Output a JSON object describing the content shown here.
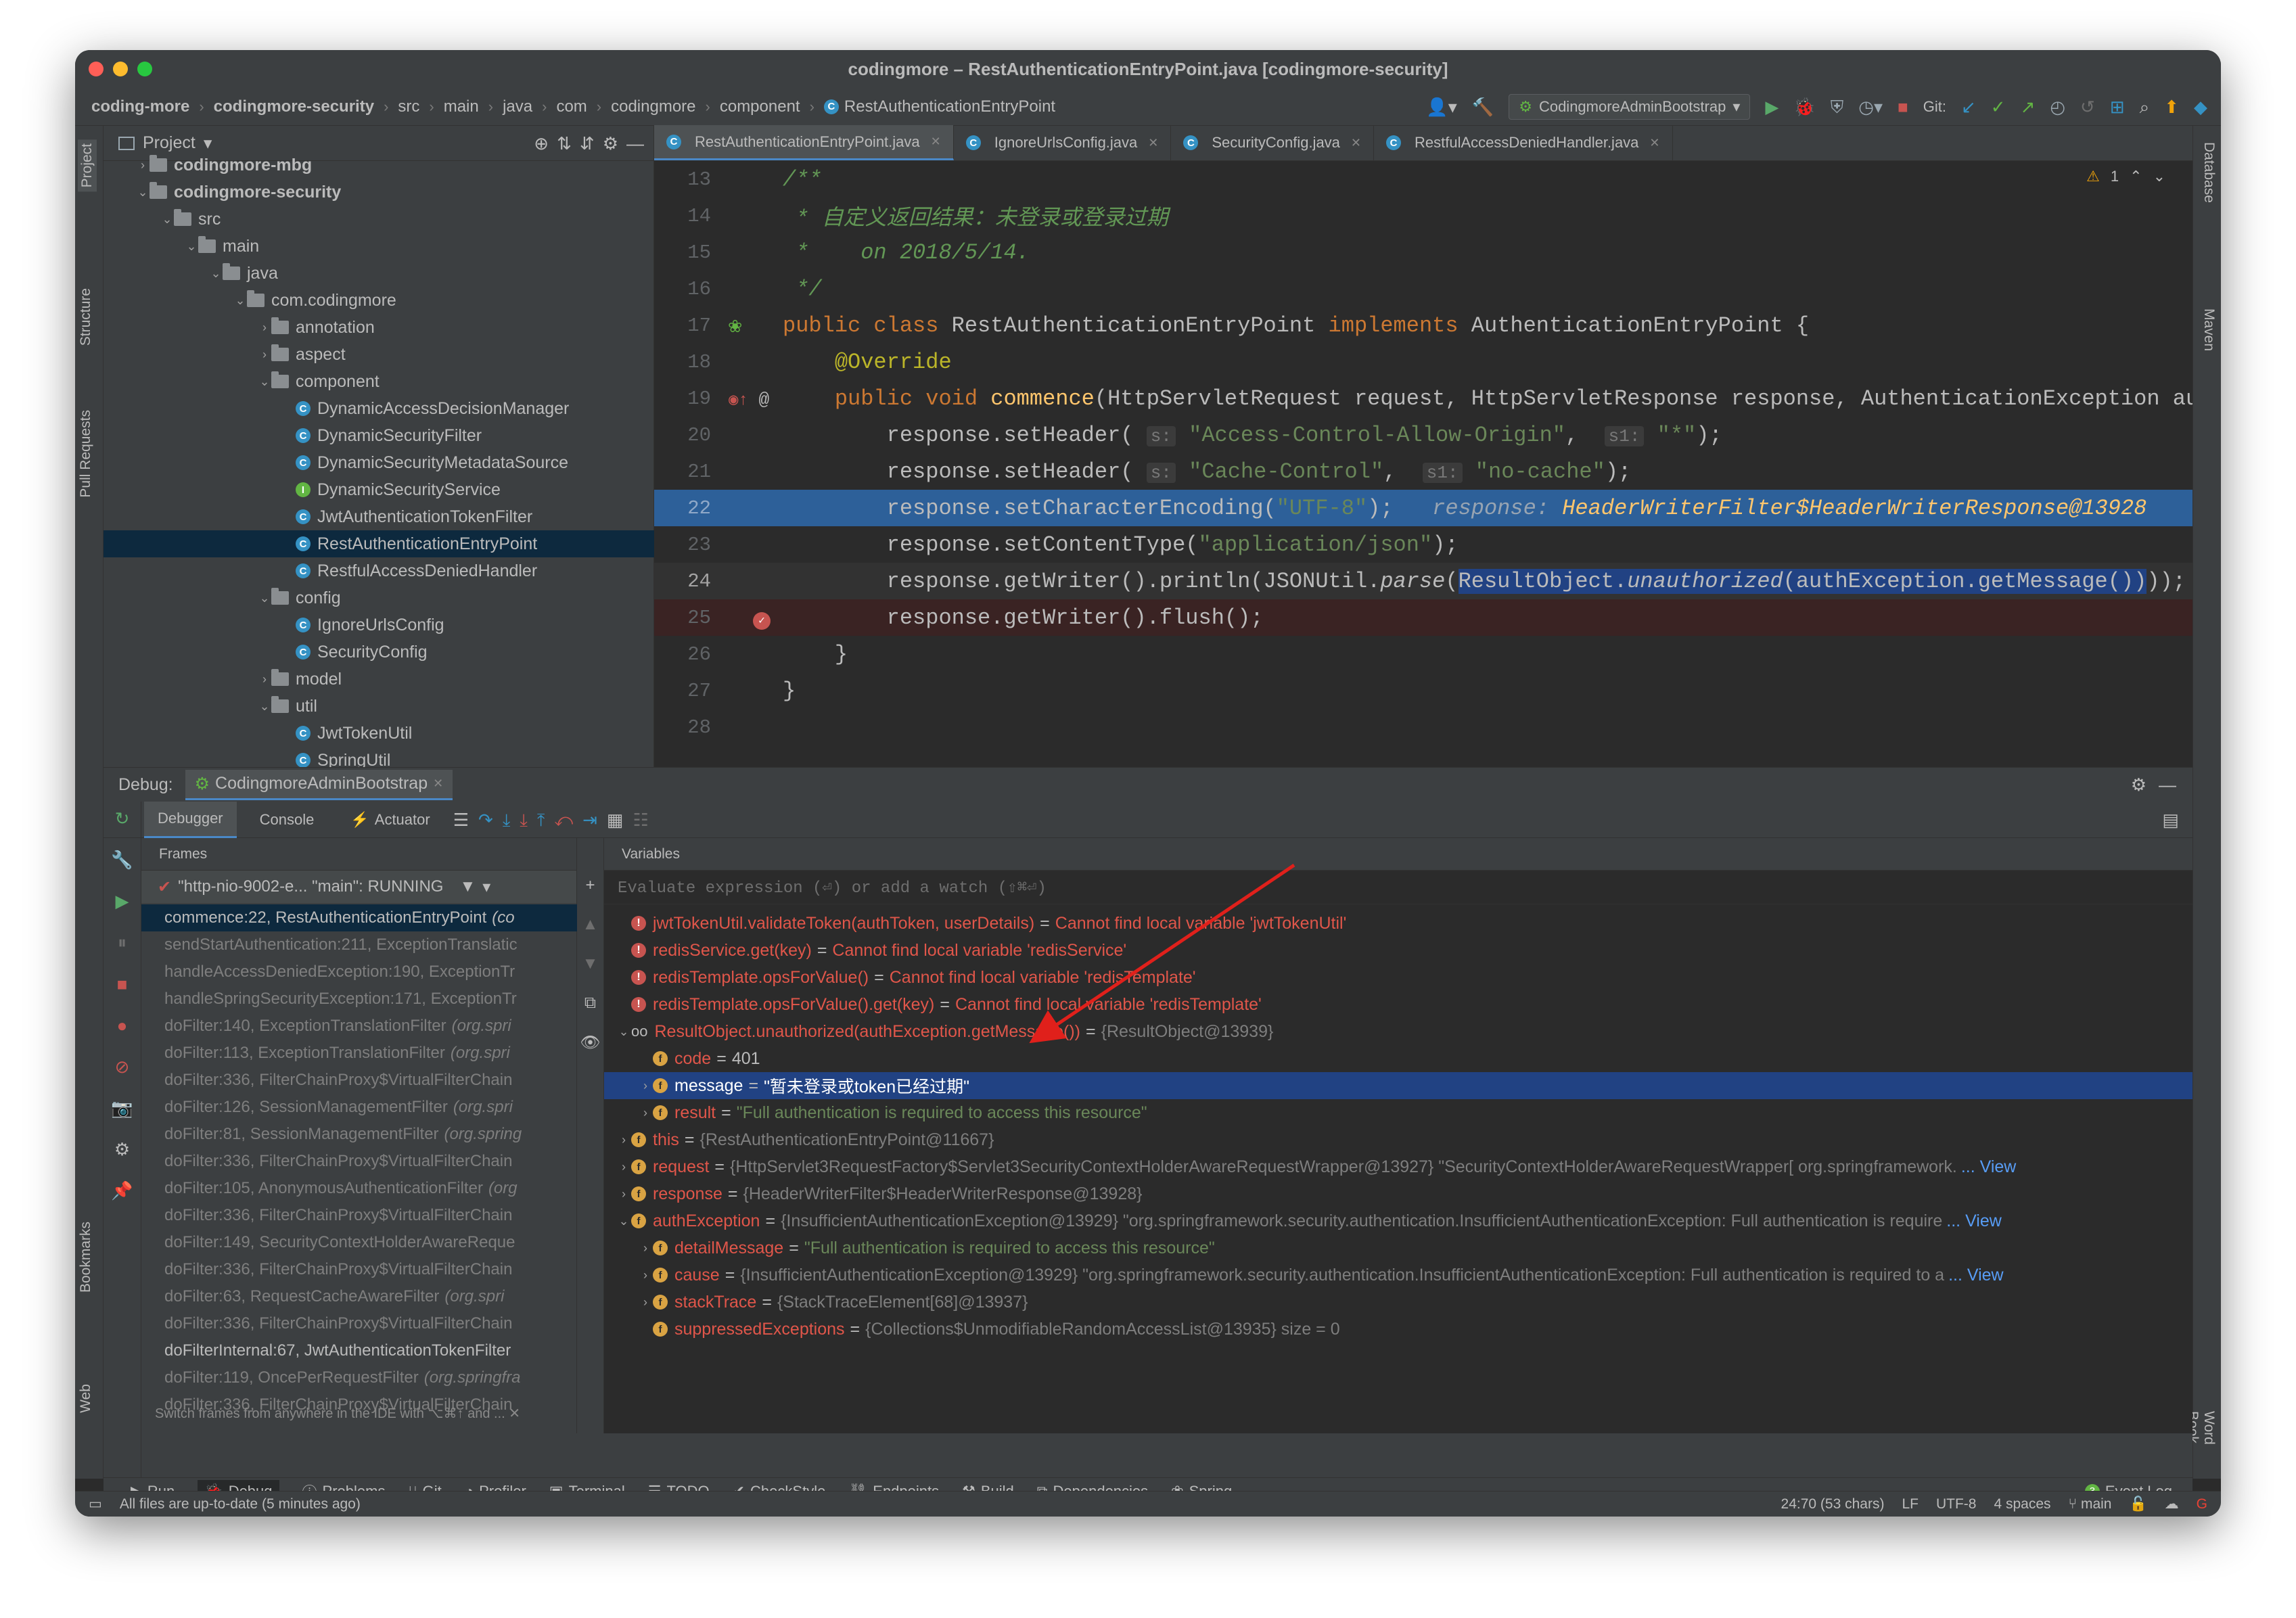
{
  "window": {
    "title": "codingmore – RestAuthenticationEntryPoint.java [codingmore-security]"
  },
  "breadcrumb": [
    "coding-more",
    "codingmore-security",
    "src",
    "main",
    "java",
    "com",
    "codingmore",
    "component",
    "RestAuthenticationEntryPoint"
  ],
  "toolbar": {
    "run_config": "CodingmoreAdminBootstrap",
    "git_label": "Git:"
  },
  "project": {
    "title": "Project",
    "items": [
      {
        "label": "codingmore-mbg",
        "type": "folder",
        "depth": 1,
        "arrow": "›"
      },
      {
        "label": "codingmore-security",
        "type": "folder",
        "depth": 1,
        "arrow": "⌄"
      },
      {
        "label": "src",
        "type": "folder",
        "depth": 2,
        "arrow": "⌄"
      },
      {
        "label": "main",
        "type": "folder",
        "depth": 3,
        "arrow": "⌄"
      },
      {
        "label": "java",
        "type": "folder",
        "depth": 4,
        "arrow": "⌄"
      },
      {
        "label": "com.codingmore",
        "type": "folder",
        "depth": 5,
        "arrow": "⌄"
      },
      {
        "label": "annotation",
        "type": "folder",
        "depth": 6,
        "arrow": "›"
      },
      {
        "label": "aspect",
        "type": "folder",
        "depth": 6,
        "arrow": "›"
      },
      {
        "label": "component",
        "type": "folder",
        "depth": 6,
        "arrow": "⌄"
      },
      {
        "label": "DynamicAccessDecisionManager",
        "type": "class",
        "depth": 7,
        "arrow": ""
      },
      {
        "label": "DynamicSecurityFilter",
        "type": "class",
        "depth": 7,
        "arrow": ""
      },
      {
        "label": "DynamicSecurityMetadataSource",
        "type": "class",
        "depth": 7,
        "arrow": ""
      },
      {
        "label": "DynamicSecurityService",
        "type": "interface",
        "depth": 7,
        "arrow": ""
      },
      {
        "label": "JwtAuthenticationTokenFilter",
        "type": "class",
        "depth": 7,
        "arrow": ""
      },
      {
        "label": "RestAuthenticationEntryPoint",
        "type": "class",
        "depth": 7,
        "arrow": "",
        "selected": true
      },
      {
        "label": "RestfulAccessDeniedHandler",
        "type": "class",
        "depth": 7,
        "arrow": ""
      },
      {
        "label": "config",
        "type": "folder",
        "depth": 6,
        "arrow": "⌄"
      },
      {
        "label": "IgnoreUrlsConfig",
        "type": "class",
        "depth": 7,
        "arrow": ""
      },
      {
        "label": "SecurityConfig",
        "type": "class",
        "depth": 7,
        "arrow": ""
      },
      {
        "label": "model",
        "type": "folder",
        "depth": 6,
        "arrow": "›"
      },
      {
        "label": "util",
        "type": "folder",
        "depth": 6,
        "arrow": "⌄"
      },
      {
        "label": "JwtTokenUtil",
        "type": "class",
        "depth": 7,
        "arrow": ""
      },
      {
        "label": "SpringUtil",
        "type": "class",
        "depth": 7,
        "arrow": ""
      }
    ]
  },
  "editor": {
    "tabs": [
      {
        "label": "RestAuthenticationEntryPoint.java",
        "active": true
      },
      {
        "label": "IgnoreUrlsConfig.java",
        "active": false
      },
      {
        "label": "SecurityConfig.java",
        "active": false
      },
      {
        "label": "RestfulAccessDeniedHandler.java",
        "active": false
      }
    ],
    "warning_count": "1",
    "line_numbers": [
      "13",
      "14",
      "15",
      "16",
      "17",
      "18",
      "19",
      "20",
      "21",
      "22",
      "23",
      "24",
      "25",
      "26",
      "27",
      "28"
    ]
  },
  "debug": {
    "label": "Debug:",
    "session": "CodingmoreAdminBootstrap",
    "tabs": [
      "Debugger",
      "Console",
      "Actuator"
    ],
    "frames_title": "Frames",
    "variables_title": "Variables",
    "thread": "\"http-nio-9002-e... \"main\": RUNNING",
    "eval_placeholder": "Evaluate expression (⏎) or add a watch (⇧⌘⏎)",
    "frames": [
      {
        "method": "commence:22, RestAuthenticationEntryPoint",
        "pkg": "(co",
        "style": "sel"
      },
      {
        "method": "sendStartAuthentication:211, ExceptionTranslatic",
        "pkg": "",
        "style": ""
      },
      {
        "method": "handleAccessDeniedException:190, ExceptionTr",
        "pkg": "",
        "style": ""
      },
      {
        "method": "handleSpringSecurityException:171, ExceptionTr",
        "pkg": "",
        "style": ""
      },
      {
        "method": "doFilter:140, ExceptionTranslationFilter",
        "pkg": "(org.spri",
        "style": ""
      },
      {
        "method": "doFilter:113, ExceptionTranslationFilter",
        "pkg": "(org.spri",
        "style": ""
      },
      {
        "method": "doFilter:336, FilterChainProxy$VirtualFilterChain",
        "pkg": "",
        "style": ""
      },
      {
        "method": "doFilter:126, SessionManagementFilter",
        "pkg": "(org.spri",
        "style": ""
      },
      {
        "method": "doFilter:81, SessionManagementFilter",
        "pkg": "(org.spring",
        "style": ""
      },
      {
        "method": "doFilter:336, FilterChainProxy$VirtualFilterChain",
        "pkg": "",
        "style": ""
      },
      {
        "method": "doFilter:105, AnonymousAuthenticationFilter",
        "pkg": "(org",
        "style": ""
      },
      {
        "method": "doFilter:336, FilterChainProxy$VirtualFilterChain",
        "pkg": "",
        "style": ""
      },
      {
        "method": "doFilter:149, SecurityContextHolderAwareReque",
        "pkg": "",
        "style": ""
      },
      {
        "method": "doFilter:336, FilterChainProxy$VirtualFilterChain",
        "pkg": "",
        "style": ""
      },
      {
        "method": "doFilter:63, RequestCacheAwareFilter",
        "pkg": "(org.spri",
        "style": ""
      },
      {
        "method": "doFilter:336, FilterChainProxy$VirtualFilterChain",
        "pkg": "",
        "style": ""
      },
      {
        "method": "doFilterInternal:67, JwtAuthenticationTokenFilter",
        "pkg": "",
        "style": "main"
      },
      {
        "method": "doFilter:119, OncePerRequestFilter",
        "pkg": "(org.springfra",
        "style": ""
      },
      {
        "method": "doFilter:336, FilterChainProxy$VirtualFilterChain",
        "pkg": "",
        "style": ""
      }
    ],
    "frames_hint": "Switch frames from anywhere in the IDE with ⌥⌘↑ and ...",
    "variables": [
      {
        "indent": 0,
        "arrow": "",
        "icon": "err",
        "name": "jwtTokenUtil.validateToken(authToken, userDetails)",
        "value": "Cannot find local variable 'jwtTokenUtil'",
        "vclass": "vmsg"
      },
      {
        "indent": 0,
        "arrow": "",
        "icon": "err",
        "name": "redisService.get(key)",
        "value": "Cannot find local variable 'redisService'",
        "vclass": "vmsg"
      },
      {
        "indent": 0,
        "arrow": "",
        "icon": "err",
        "name": "redisTemplate.opsForValue()",
        "value": "Cannot find local variable 'redisTemplate'",
        "vclass": "vmsg"
      },
      {
        "indent": 0,
        "arrow": "",
        "icon": "err",
        "name": "redisTemplate.opsForValue().get(key)",
        "value": "Cannot find local variable 'redisTemplate'",
        "vclass": "vmsg"
      },
      {
        "indent": 0,
        "arrow": "⌄",
        "icon": "watch",
        "name": "ResultObject.unauthorized(authException.getMessage())",
        "value": "{ResultObject@13939}",
        "vclass": "vref"
      },
      {
        "indent": 1,
        "arrow": "",
        "icon": "fld",
        "name": "code",
        "value": "401",
        "vclass": "vnum"
      },
      {
        "indent": 1,
        "arrow": "›",
        "icon": "fld",
        "name": "message",
        "value": "\"暂未登录或token已经过期\"",
        "vclass": "vnum",
        "selected": true
      },
      {
        "indent": 1,
        "arrow": "›",
        "icon": "fld",
        "name": "result",
        "value": "\"Full authentication is required to access this resource\"",
        "vclass": "vstr"
      },
      {
        "indent": 0,
        "arrow": "›",
        "icon": "fld",
        "name": "this",
        "value": "{RestAuthenticationEntryPoint@11667}",
        "vclass": "vref"
      },
      {
        "indent": 0,
        "arrow": "›",
        "icon": "fld",
        "name": "request",
        "value": "{HttpServlet3RequestFactory$Servlet3SecurityContextHolderAwareRequestWrapper@13927} \"SecurityContextHolderAwareRequestWrapper[ org.springframework.",
        "vclass": "vref",
        "link": "... View"
      },
      {
        "indent": 0,
        "arrow": "›",
        "icon": "fld",
        "name": "response",
        "value": "{HeaderWriterFilter$HeaderWriterResponse@13928}",
        "vclass": "vref"
      },
      {
        "indent": 0,
        "arrow": "⌄",
        "icon": "fld",
        "name": "authException",
        "value": "{InsufficientAuthenticationException@13929} \"org.springframework.security.authentication.InsufficientAuthenticationException: Full authentication is require",
        "vclass": "vref",
        "link": "... View"
      },
      {
        "indent": 1,
        "arrow": "›",
        "icon": "fld",
        "name": "detailMessage",
        "value": "\"Full authentication is required to access this resource\"",
        "vclass": "vstr"
      },
      {
        "indent": 1,
        "arrow": "›",
        "icon": "fld",
        "name": "cause",
        "value": "{InsufficientAuthenticationException@13929} \"org.springframework.security.authentication.InsufficientAuthenticationException: Full authentication is required to a",
        "vclass": "vref",
        "link": "... View"
      },
      {
        "indent": 1,
        "arrow": "›",
        "icon": "fld",
        "name": "stackTrace",
        "value": "{StackTraceElement[68]@13937}",
        "vclass": "vref"
      },
      {
        "indent": 1,
        "arrow": "",
        "icon": "fld",
        "name": "suppressedExceptions",
        "value": "{Collections$UnmodifiableRandomAccessList@13935}  size = 0",
        "vclass": "vref"
      }
    ]
  },
  "bottom_tools": [
    "Run",
    "Debug",
    "Problems",
    "Git",
    "Profiler",
    "Terminal",
    "TODO",
    "CheckStyle",
    "Endpoints",
    "Build",
    "Dependencies",
    "Spring"
  ],
  "event_log": {
    "count": "3",
    "label": "Event Log"
  },
  "status": {
    "message": "All files are up-to-date (5 minutes ago)",
    "position": "24:70 (53 chars)",
    "line_sep": "LF",
    "encoding": "UTF-8",
    "indent": "4 spaces",
    "branch": "main"
  },
  "side_tabs": {
    "left": [
      "Project",
      "Structure",
      "Pull Requests",
      "Bookmarks",
      "Web"
    ],
    "right": [
      "Database",
      "Maven",
      "Word Book"
    ]
  },
  "colors": {
    "accent": "#4a88c7",
    "selection": "#214283",
    "exec_line": "#2d6099",
    "error": "#c75450",
    "annotation_arrow": "#e0201b"
  }
}
